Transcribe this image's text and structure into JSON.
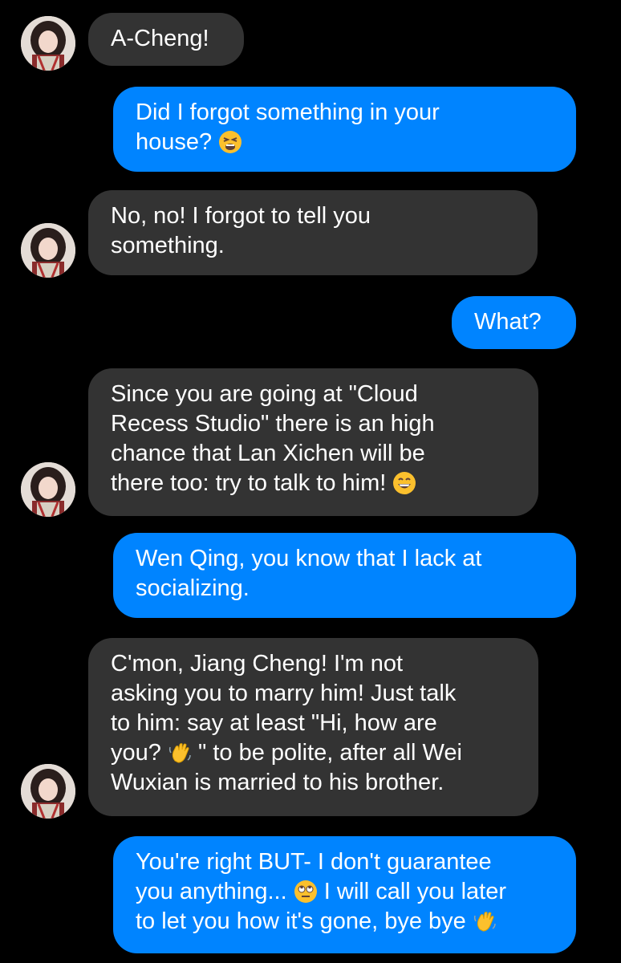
{
  "messages": [
    {
      "id": "m1",
      "direction": "incoming",
      "lines": [
        "A-Cheng!"
      ]
    },
    {
      "id": "m2",
      "direction": "outgoing",
      "lines": [
        "Did I forgot something in your",
        "house?"
      ],
      "emoji": "tired-face-emoji"
    },
    {
      "id": "m3",
      "direction": "incoming",
      "lines": [
        "No, no! I forgot to tell you",
        "something."
      ]
    },
    {
      "id": "m4",
      "direction": "outgoing",
      "lines": [
        "What?"
      ]
    },
    {
      "id": "m5",
      "direction": "incoming",
      "lines": [
        "Since you are going at \"Cloud",
        "Recess Studio\" there is an high",
        "chance that Lan Xichen will be",
        "there too: try to talk to him!"
      ],
      "emoji": "grinning-face-emoji"
    },
    {
      "id": "m6",
      "direction": "outgoing",
      "lines": [
        "Wen Qing, you know that I lack at",
        "socializing."
      ]
    },
    {
      "id": "m7",
      "direction": "incoming",
      "lines": [
        "C'mon, Jiang Cheng! I'm not",
        "asking you to marry him! Just talk",
        "to him: say at least \"Hi, how are",
        "you?",
        "\" to be polite, after all Wei",
        "Wuxian is married to his brother."
      ],
      "emoji": "waving-hand-emoji"
    },
    {
      "id": "m8",
      "direction": "outgoing",
      "lines": [
        "You're right BUT- I don't guarantee",
        "you anything...",
        "I will call you later",
        "to let you how it's gone, bye bye"
      ],
      "emojis": [
        "eye-roll-emoji",
        "waving-hand-emoji"
      ]
    }
  ],
  "theme": {
    "background": "#000000",
    "incoming_bubble": "#333333",
    "outgoing_bubble": "#0084ff",
    "text": "#ffffff"
  }
}
